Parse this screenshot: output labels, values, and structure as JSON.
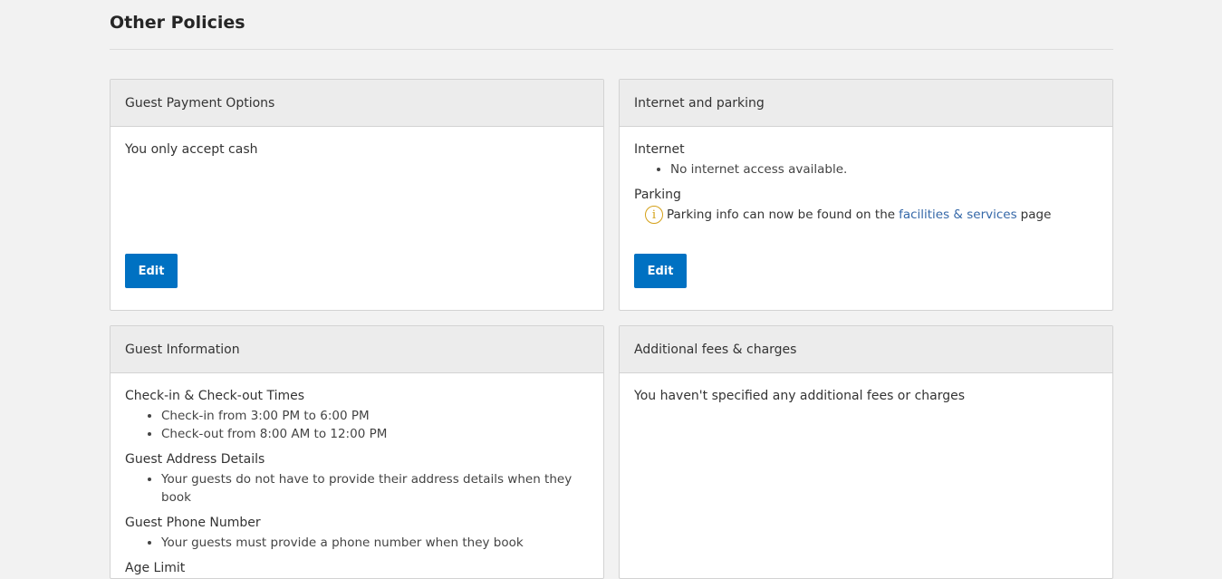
{
  "page": {
    "title": "Other Policies"
  },
  "payment": {
    "title": "Guest Payment Options",
    "text": "You only accept cash",
    "edit_label": "Edit"
  },
  "internet_parking": {
    "title": "Internet and parking",
    "internet_label": "Internet",
    "internet_items": [
      "No internet access available."
    ],
    "parking_label": "Parking",
    "parking_text_before": "Parking info can now be found on the",
    "parking_link": "facilities & services",
    "parking_text_after": "page",
    "edit_label": "Edit"
  },
  "guest_info": {
    "title": "Guest Information",
    "checkin_label": "Check-in & Check-out Times",
    "checkin_items": [
      "Check-in from 3:00 PM to 6:00 PM",
      "Check-out from 8:00 AM to 12:00 PM"
    ],
    "address_label": "Guest Address Details",
    "address_items": [
      "Your guests do not have to provide their address details when they book"
    ],
    "phone_label": "Guest Phone Number",
    "phone_items": [
      "Your guests must provide a phone number when they book"
    ],
    "age_label": "Age Limit"
  },
  "fees": {
    "title": "Additional fees & charges",
    "text": "You haven't specified any additional fees or charges"
  },
  "colors": {
    "accent": "#0071c2",
    "link": "#3568a8",
    "info": "#d4a017"
  }
}
